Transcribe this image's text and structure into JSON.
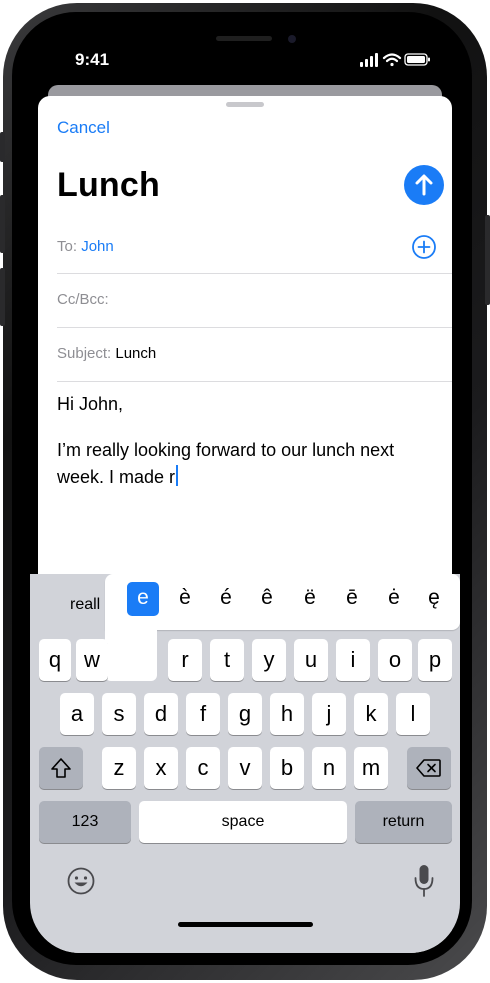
{
  "status": {
    "time": "9:41"
  },
  "compose": {
    "cancel": "Cancel",
    "title": "Lunch",
    "to_label": "To:",
    "to_value": "John",
    "cc_label": "Cc/Bcc:",
    "subject_label": "Subject:",
    "subject_value": "Lunch",
    "body_line1": "Hi John,",
    "body_line2": "I’m really looking forward to our lunch next",
    "body_line3": "week. I made r"
  },
  "keyboard": {
    "suggestion": "reall",
    "accents": [
      "e",
      "è",
      "é",
      "ê",
      "ë",
      "ē",
      "ė",
      "ę"
    ],
    "row1": [
      "q",
      "w",
      "r",
      "t",
      "y",
      "u",
      "i",
      "o",
      "p"
    ],
    "row2": [
      "a",
      "s",
      "d",
      "f",
      "g",
      "h",
      "j",
      "k",
      "l"
    ],
    "row3": [
      "z",
      "x",
      "c",
      "v",
      "b",
      "n",
      "m"
    ],
    "numbers": "123",
    "space": "space",
    "return": "return"
  },
  "colors": {
    "accent": "#1a7cf6"
  },
  "icons": [
    "send-arrow-icon",
    "add-contact-icon",
    "shift-icon",
    "delete-icon",
    "emoji-icon",
    "microphone-icon",
    "signal-icon",
    "wifi-icon",
    "battery-icon"
  ]
}
